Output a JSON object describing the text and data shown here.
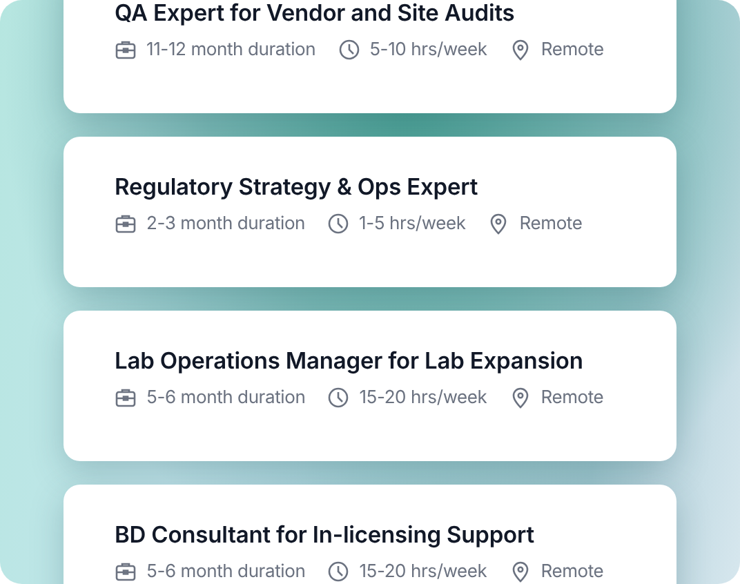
{
  "jobs": [
    {
      "title": "QA Expert for Vendor and Site Audits",
      "duration": "11-12 month duration",
      "hours": "5-10 hrs/week",
      "location": "Remote"
    },
    {
      "title": "Regulatory Strategy & Ops Expert",
      "duration": "2-3 month duration",
      "hours": "1-5 hrs/week",
      "location": "Remote"
    },
    {
      "title": "Lab Operations Manager for Lab Expansion",
      "duration": "5-6 month duration",
      "hours": "15-20 hrs/week",
      "location": "Remote"
    },
    {
      "title": "BD Consultant for In-licensing Support",
      "duration": "5-6 month duration",
      "hours": "15-20 hrs/week",
      "location": "Remote"
    }
  ]
}
